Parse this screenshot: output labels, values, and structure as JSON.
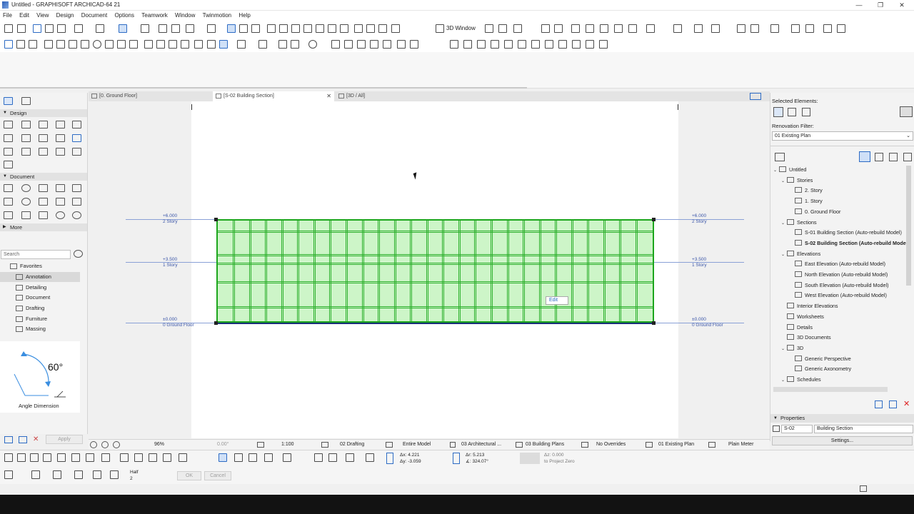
{
  "window": {
    "title": "Untitled - GRAPHISOFT ARCHICAD-64 21",
    "min_glyph": "—",
    "max_glyph": "❐",
    "close_glyph": "✕"
  },
  "menu": [
    "File",
    "Edit",
    "View",
    "Design",
    "Document",
    "Options",
    "Teamwork",
    "Window",
    "Twinmotion",
    "Help"
  ],
  "toolbar": {
    "window_3d_label": "3D Window"
  },
  "toolbox": {
    "design_header": "Design",
    "document_header": "Document",
    "more_header": "More",
    "search_placeholder": "Search",
    "favorites_label": "Favorites",
    "favorites": [
      "Annotation",
      "Detailing",
      "Document",
      "Drafting",
      "Furniture",
      "Massing"
    ],
    "preview_angle": "60°",
    "preview_caption": "Angle Dimension",
    "apply_label": "Apply"
  },
  "tabs": [
    {
      "label": "[0. Ground Floor]"
    },
    {
      "label": "[S-02 Building Section]"
    },
    {
      "label": "[3D / All]"
    }
  ],
  "section": {
    "levels": [
      {
        "elev": "+6.000",
        "name": "2 Story"
      },
      {
        "elev": "+3.500",
        "name": "1 Story"
      },
      {
        "elev": "±0.000",
        "name": "0 Ground Floor"
      }
    ],
    "edit_label": "Edit",
    "colors": {
      "curtain_fill": "#cdf5c8",
      "curtain_stroke": "#1ca61c",
      "level_line": "#8aa0d6"
    }
  },
  "right_panel": {
    "selected_elements_label": "Selected Elements:",
    "renovation_filter_label": "Renovation Filter:",
    "renovation_filter_value": "01 Existing Plan",
    "tree": [
      {
        "label": "Untitled",
        "indent": 0,
        "expand": "v"
      },
      {
        "label": "Stories",
        "indent": 1,
        "expand": "v"
      },
      {
        "label": "2. Story",
        "indent": 2
      },
      {
        "label": "1. Story",
        "indent": 2
      },
      {
        "label": "0. Ground Floor",
        "indent": 2
      },
      {
        "label": "Sections",
        "indent": 1,
        "expand": "v"
      },
      {
        "label": "S-01 Building Section (Auto-rebuild Model)",
        "indent": 2
      },
      {
        "label": "S-02 Building Section (Auto-rebuild Model)",
        "indent": 2,
        "selected": true
      },
      {
        "label": "Elevations",
        "indent": 1,
        "expand": "v"
      },
      {
        "label": "East Elevation (Auto-rebuild Model)",
        "indent": 2
      },
      {
        "label": "North Elevation (Auto-rebuild Model)",
        "indent": 2
      },
      {
        "label": "South Elevation (Auto-rebuild Model)",
        "indent": 2
      },
      {
        "label": "West Elevation (Auto-rebuild Model)",
        "indent": 2
      },
      {
        "label": "Interior Elevations",
        "indent": 1
      },
      {
        "label": "Worksheets",
        "indent": 1
      },
      {
        "label": "Details",
        "indent": 1
      },
      {
        "label": "3D Documents",
        "indent": 1
      },
      {
        "label": "3D",
        "indent": 1,
        "expand": "v"
      },
      {
        "label": "Generic Perspective",
        "indent": 2
      },
      {
        "label": "Generic Axonometry",
        "indent": 2
      },
      {
        "label": "Schedules",
        "indent": 1,
        "expand": "v"
      }
    ],
    "properties_label": "Properties",
    "prop_id": "S-02",
    "prop_name": "Building Section",
    "settings_label": "Settings..."
  },
  "status": {
    "zoom": "96%",
    "angle": "0.00°",
    "scale": "1:100",
    "layer_combo": "02 Drafting",
    "model_view": "Entire Model",
    "pen_set": "03 Architectural ...",
    "mvo": "03 Building Plans",
    "overrides": "No Overrides",
    "renovation": "01 Existing Plan",
    "dimension": "Plain Meter"
  },
  "coords": {
    "dx": "Δx: 4.221",
    "dy": "Δy: -3.059",
    "dr": "Δr: 5.213",
    "da": "∡: 324.07°",
    "dz": "Δz: 0.000",
    "ref": "to Project Zero",
    "half_label": "Half",
    "half_value": "2",
    "ok_label": "OK",
    "cancel_label": "Cancel"
  }
}
